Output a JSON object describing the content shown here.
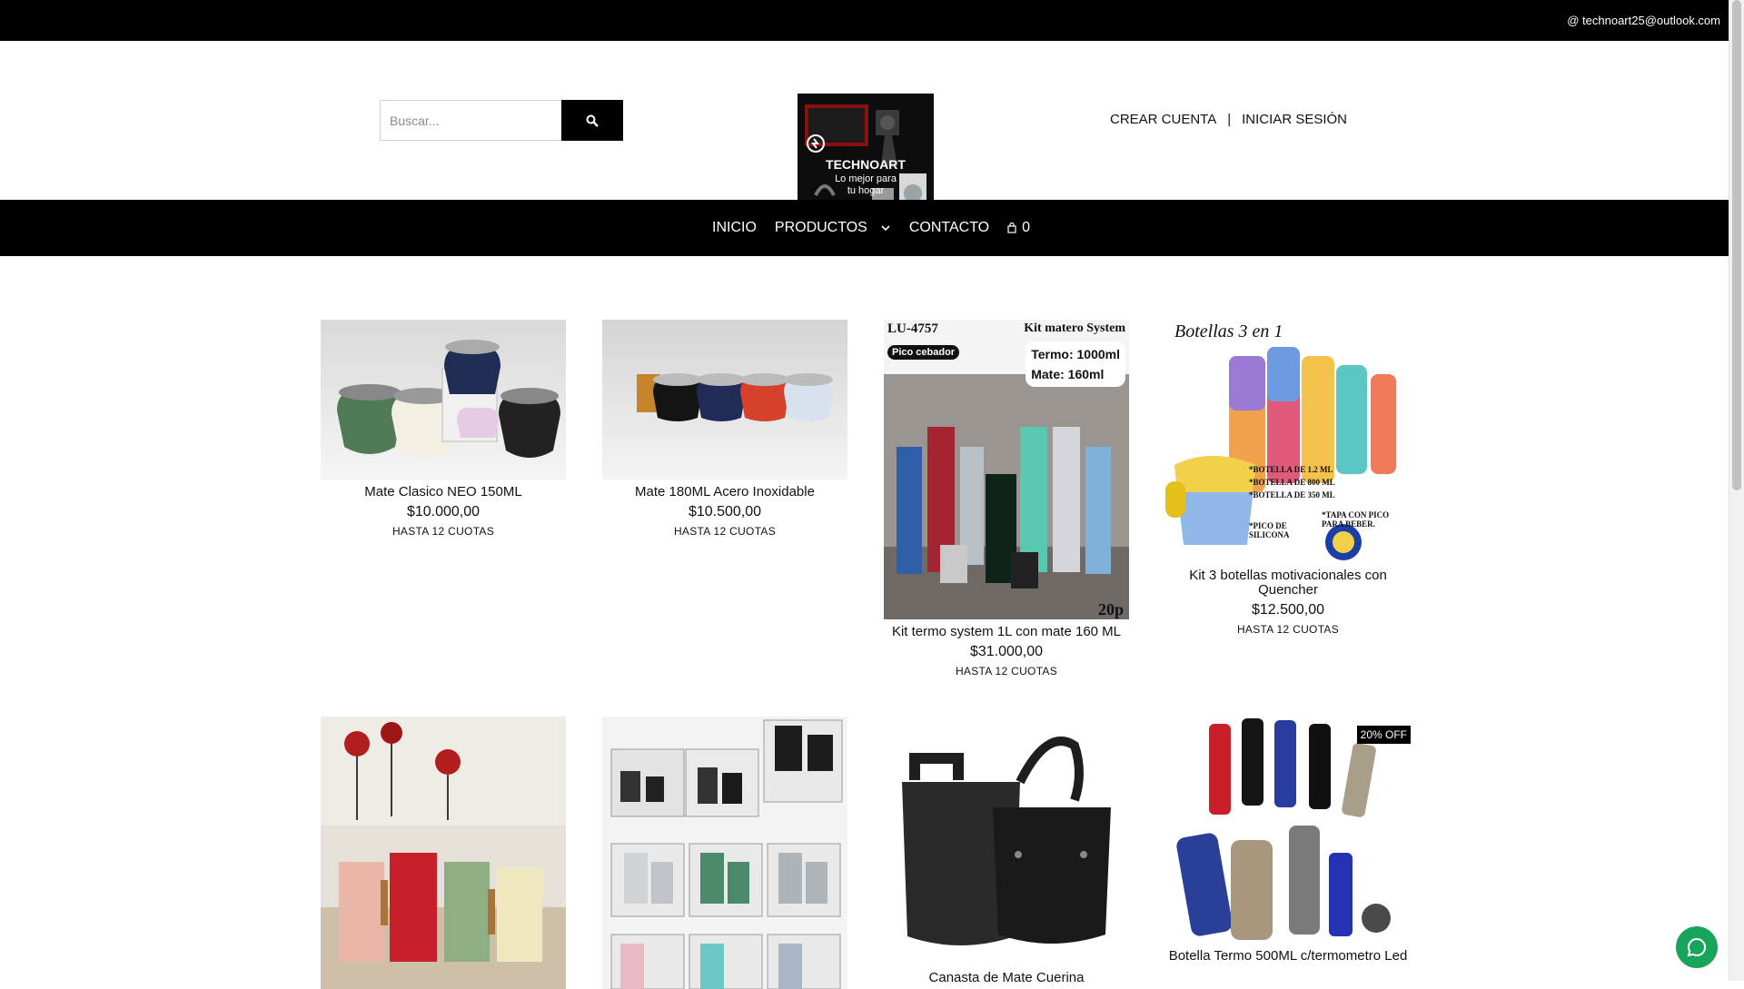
{
  "topbar": {
    "email": "@ technoart25@outlook.com"
  },
  "search": {
    "placeholder": "Buscar..."
  },
  "logo": {
    "brand": "TECHNOART",
    "tagline_1": "Lo mejor para",
    "tagline_2": "tu hogar"
  },
  "account": {
    "create": "CREAR CUENTA",
    "separator": "|",
    "login": "INICIAR SESIÓN"
  },
  "nav": {
    "inicio": "INICIO",
    "productos": "PRODUCTOS",
    "contacto": "CONTACTO",
    "cart_count": "0"
  },
  "products": [
    {
      "name": "Mate Clasico NEO 150ML",
      "price": "$10.000,00",
      "installments": "HASTA 12 CUOTAS"
    },
    {
      "name": "Mate 180ML Acero Inoxidable",
      "price": "$10.500,00",
      "installments": "HASTA 12 CUOTAS"
    },
    {
      "name": "Kit termo system 1L con mate 160 ML",
      "price": "$31.000,00",
      "installments": "HASTA 12 CUOTAS",
      "image_text": {
        "code": "LU-4757",
        "title": "Kit matero System",
        "termo": "Termo: 1000ml",
        "mate": "Mate: 160ml",
        "badge": "Pico cebador",
        "qty": "20p"
      }
    },
    {
      "name": "Kit 3 botellas motivacionales con Quencher",
      "price": "$12.500,00",
      "installments": "HASTA 12 CUOTAS",
      "image_text": {
        "title": "Botellas 3 en 1",
        "l1": "*BOTELLA DE 1.2 ML",
        "l2": "*BOTELLA DE 800 ML",
        "l3": "*BOTELLA DE 350 ML",
        "l4": "*PICO DE SILICONA",
        "l5": "*TAPA CON PICO PARA BEBER."
      }
    },
    {
      "name": "",
      "price": "",
      "installments": ""
    },
    {
      "name": "",
      "price": "",
      "installments": ""
    },
    {
      "name": "Canasta de Mate Cuerina",
      "price": "",
      "installments": ""
    },
    {
      "name": "Botella Termo 500ML c/termometro Led",
      "price": "",
      "installments": "",
      "badge": "20% OFF"
    }
  ],
  "colors": {
    "topbar": "#000000",
    "nav": "#000000",
    "whatsapp": "#19a45b"
  },
  "icons": [
    "search-icon",
    "chevron-down-icon",
    "cart-icon",
    "whatsapp-icon"
  ]
}
